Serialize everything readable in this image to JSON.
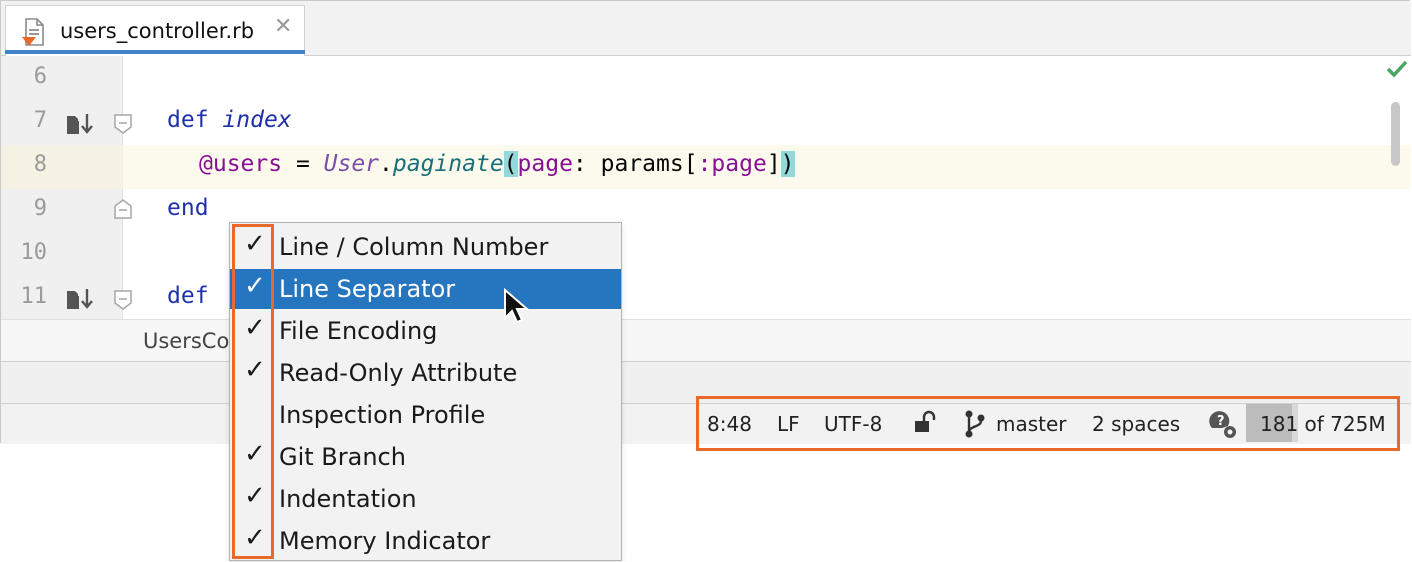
{
  "tab": {
    "filename": "users_controller.rb",
    "close_glyph": "✕",
    "icon": "ruby-file-icon"
  },
  "editor": {
    "lines": [
      {
        "number": "6"
      },
      {
        "number": "7",
        "gutter_icon": "implemented-method-icon"
      },
      {
        "number": "8"
      },
      {
        "number": "9"
      },
      {
        "number": "10"
      },
      {
        "number": "11",
        "gutter_icon": "implemented-method-icon"
      }
    ],
    "code": {
      "l7_kw": "def",
      "l7_name": "index",
      "l8_ivar": "@users",
      "l8_eq": " = ",
      "l8_class": "User",
      "l8_dot": ".",
      "l8_method": "paginate",
      "l8_open": "(",
      "l8_key": "page",
      "l8_colon": ": ",
      "l8_params": "params[",
      "l8_sym": ":page",
      "l8_close_bracket": "]",
      "l8_close": ")",
      "l9_kw": "end",
      "l11_kw": "def"
    },
    "inspection_status": "checkmark-ok-icon"
  },
  "breadcrumb": {
    "text": "UsersCo"
  },
  "status_bar": {
    "position": "8:48",
    "line_separator": "LF",
    "encoding": "UTF-8",
    "readonly_icon": "unlock-icon",
    "branch_icon": "git-branch-icon",
    "branch": "master",
    "indent": "2 spaces",
    "inspection_icon": "inspection-profile-icon",
    "memory": "181 of 725M",
    "memory_used_fraction": 0.25
  },
  "popup_menu": {
    "items": [
      {
        "label": "Line / Column Number",
        "check": "✓"
      },
      {
        "label": "Line Separator",
        "check": "✓"
      },
      {
        "label": "File Encoding",
        "check": "✓"
      },
      {
        "label": "Read-Only Attribute",
        "check": "✓"
      },
      {
        "label": "Inspection Profile",
        "check": ""
      },
      {
        "label": "Git Branch",
        "check": "✓"
      },
      {
        "label": "Indentation",
        "check": "✓"
      },
      {
        "label": "Memory Indicator",
        "check": "✓"
      }
    ],
    "selected_index": 1
  },
  "colors": {
    "highlight": "#e8692a",
    "selection": "#2675bf",
    "accent_tab": "#4083c9"
  }
}
